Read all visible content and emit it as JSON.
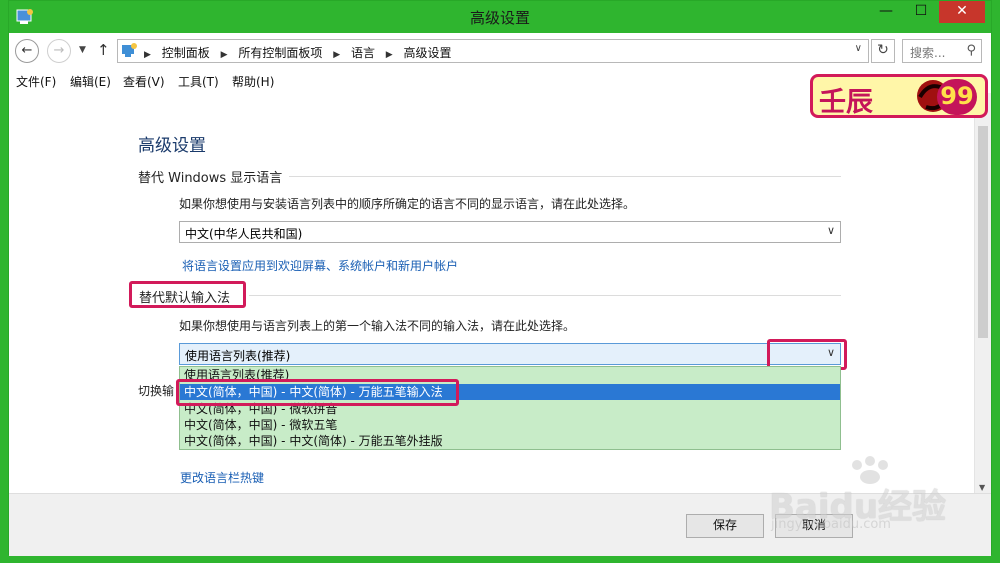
{
  "window": {
    "title": "高级设置",
    "controls": {
      "minimize": "—",
      "maximize": "☐",
      "close": "✕"
    }
  },
  "address_bar": {
    "breadcrumbs": [
      "控制面板",
      "所有控制面板项",
      "语言",
      "高级设置"
    ],
    "search_placeholder": "搜索...",
    "icons": [
      "back-arrow-icon",
      "forward-arrow-icon",
      "chevron-down-icon",
      "up-arrow-icon",
      "control-panel-icon",
      "refresh-icon",
      "search-icon"
    ]
  },
  "menu": {
    "items": [
      "文件(F)",
      "编辑(E)",
      "查看(V)",
      "工具(T)",
      "帮助(H)"
    ]
  },
  "content": {
    "heading": "高级设置",
    "display_language": {
      "title": "替代 Windows 显示语言",
      "description": "如果你想使用与安装语言列表中的顺序所确定的语言不同的显示语言，请在此处选择。",
      "selected": "中文(中华人民共和国)",
      "link": "将语言设置应用到欢迎屏幕、系统帐户和新用户帐户"
    },
    "input_method": {
      "title": "替代默认输入法",
      "description": "如果你想使用与语言列表上的第一个输入法不同的输入法，请在此处选择。",
      "selected": "使用语言列表(推荐)",
      "options": [
        "使用语言列表(推荐)",
        "中文(简体，中国) - 中文(简体) - 万能五笔输入法",
        "中文(简体，中国) - 微软拼音",
        "中文(简体，中国) - 微软五笔",
        "中文(简体，中国) - 中文(简体) - 万能五笔外挂版"
      ],
      "highlighted_option_index": 1
    },
    "switch_label": "切换输",
    "hotkey_link": "更改语言栏热键"
  },
  "footer": {
    "save_label": "保存",
    "cancel_label": "取消"
  },
  "badge": {
    "text": "壬辰",
    "number": "99"
  },
  "watermark": {
    "text": "Baidu经验",
    "url": "jingyan.baidu.com"
  },
  "colors": {
    "titlebar": "#2fb52f",
    "highlight_border": "#d21a5a",
    "dropdown_bg": "#c8ecc8",
    "selected_option": "#2a78d4",
    "link": "#1a5fb4"
  }
}
